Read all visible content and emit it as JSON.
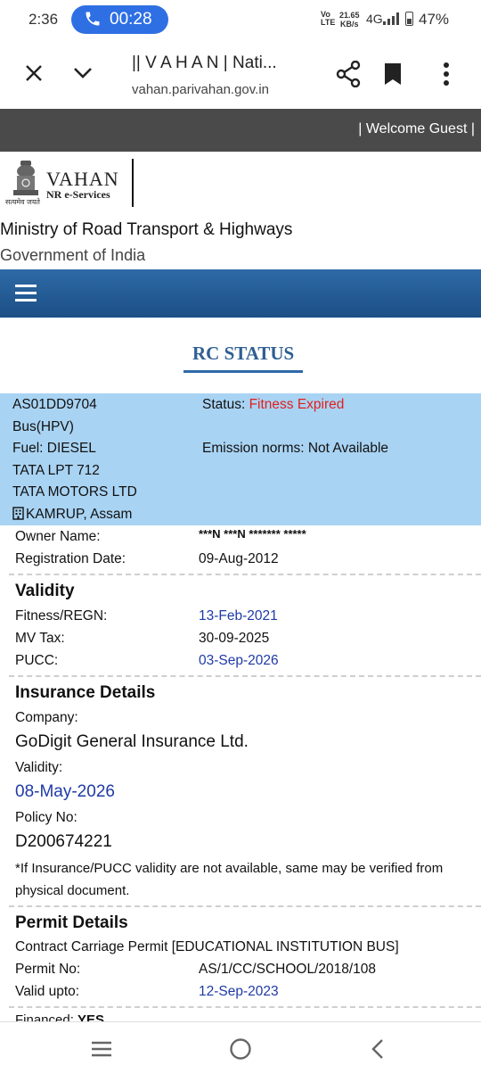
{
  "status_bar": {
    "time": "2:36",
    "call_timer": "00:28",
    "network_type": "VoLTE",
    "speed_value": "21.65",
    "speed_unit": "KB/s",
    "mobile_data": "4G",
    "battery": "47%"
  },
  "browser": {
    "page_title": "|| V A H A N | Nati...",
    "url": "vahan.parivahan.gov.in"
  },
  "site": {
    "welcome": "| Welcome Guest |",
    "logo_text": "VAHAN",
    "logo_subtext": "NR e-Services",
    "emblem_caption": "सत्यमेव जयते",
    "ministry": "Ministry of Road Transport & Highways",
    "government": "Government of India",
    "page_heading": "RC STATUS"
  },
  "vehicle": {
    "reg_no": "AS01DD9704",
    "class": "Bus(HPV)",
    "fuel": "Fuel: DIESEL",
    "model": "TATA LPT 712",
    "maker": "TATA MOTORS LTD",
    "rto": "KAMRUP, Assam",
    "status_label": "Status:",
    "status_value": "Fitness Expired",
    "emission": "Emission norms: Not Available"
  },
  "owner": {
    "owner_label": "Owner Name:",
    "owner_value": "***N ***N ******* *****",
    "reg_date_label": "Registration Date:",
    "reg_date_value": "09-Aug-2012"
  },
  "validity": {
    "heading": "Validity",
    "fitness_label": "Fitness/REGN:",
    "fitness_value": "13-Feb-2021",
    "mvtax_label": "MV Tax:",
    "mvtax_value": "30-09-2025",
    "pucc_label": "PUCC:",
    "pucc_value": "03-Sep-2026"
  },
  "insurance": {
    "heading": "Insurance Details",
    "company_label": "Company:",
    "company_value": "GoDigit General Insurance Ltd.",
    "validity_label": "Validity:",
    "validity_value": "08-May-2026",
    "policy_label": "Policy No:",
    "policy_value": "D200674221",
    "note": "*If Insurance/PUCC validity are not available, same may be verified from physical document."
  },
  "permit": {
    "heading": "Permit Details",
    "type": "Contract Carriage Permit [EDUCATIONAL INSTITUTION BUS]",
    "permit_no_label": "Permit No:",
    "permit_no_value": "AS/1/CC/SCHOOL/2018/108",
    "valid_upto_label": "Valid upto:",
    "valid_upto_value": "12-Sep-2023",
    "financed_label": "Financed:",
    "financed_value": "YES"
  },
  "icons": {
    "close": "close-icon",
    "chevron": "chevron-down-icon",
    "share": "share-icon",
    "bookmark": "bookmark-icon",
    "more": "more-vert-icon",
    "menu": "hamburger-icon",
    "rto": "building-icon"
  },
  "colors": {
    "nav_blue": "#1c4f86",
    "summary_bg": "#a9d3f3",
    "alert_red": "#e0201d",
    "date_blue": "#1f3aa6",
    "call_pill": "#2f6fe4"
  }
}
